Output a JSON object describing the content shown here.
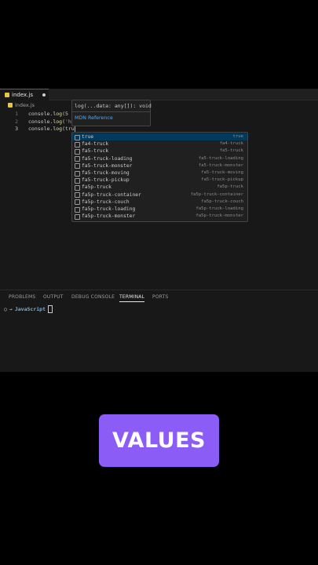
{
  "tabs": [
    {
      "label": "index.js",
      "modified": true
    }
  ],
  "breadcrumb": "index.js",
  "editor": {
    "lines": [
      {
        "number": "1",
        "prefix": "console.",
        "fn": "log",
        "rest": "(5 ="
      },
      {
        "number": "2",
        "prefix": "console.",
        "fn": "log",
        "open": "(",
        "str": "'he"
      },
      {
        "number": "3",
        "prefix": "console.",
        "fn": "log",
        "rest": "(tru"
      }
    ]
  },
  "hover": {
    "signature": "log(...data: any[]): void",
    "link": "MDN Reference"
  },
  "suggestions": [
    {
      "label": "true",
      "detail": "true"
    },
    {
      "label": "fa4-truck",
      "detail": "fa4-truck"
    },
    {
      "label": "fa5-truck",
      "detail": "fa5-truck"
    },
    {
      "label": "fa5-truck-loading",
      "detail": "fa5-truck-loading"
    },
    {
      "label": "fa5-truck-monster",
      "detail": "fa5-truck-monster"
    },
    {
      "label": "fa5-truck-moving",
      "detail": "fa5-truck-moving"
    },
    {
      "label": "fa5-truck-pickup",
      "detail": "fa5-truck-pickup"
    },
    {
      "label": "fa5p-truck",
      "detail": "fa5p-truck"
    },
    {
      "label": "fa5p-truck-container",
      "detail": "fa5p-truck-container"
    },
    {
      "label": "fa5p-truck-couch",
      "detail": "fa5p-truck-couch"
    },
    {
      "label": "fa5p-truck-loading",
      "detail": "fa5p-truck-loading"
    },
    {
      "label": "fa5p-truck-monster",
      "detail": "fa5p-truck-monster"
    }
  ],
  "panel": {
    "tabs": [
      "PROBLEMS",
      "OUTPUT",
      "DEBUG CONSOLE",
      "TERMINAL",
      "PORTS"
    ],
    "active_tab": "TERMINAL",
    "prompt_name": "JavaScript"
  },
  "banner": "VALUES",
  "colors": {
    "accent": "#8b5cf6",
    "selection": "#04395e",
    "link": "#4daafc"
  },
  "icons": {
    "file": "js-file-icon",
    "suggestion": "symbol-icon",
    "terminal": "terminal-prompt-icon"
  }
}
